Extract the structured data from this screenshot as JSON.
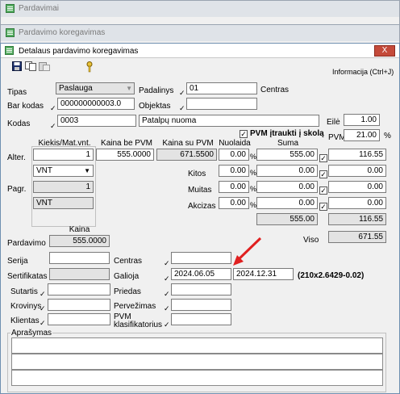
{
  "bg_windows": [
    "Pardavimai",
    "Pardavimo koregavimas"
  ],
  "dialog_title": "Detalaus pardavimo koregavimas",
  "close_label": "X",
  "info_label": "Informacija (Ctrl+J)",
  "form": {
    "tipas": {
      "label": "Tipas",
      "value": "Paslauga"
    },
    "padalinys": {
      "label": "Padalinys",
      "value": "01",
      "name": "Centras"
    },
    "barkodas": {
      "label": "Bar kodas",
      "value": "000000000003.0"
    },
    "objektas": {
      "label": "Objektas",
      "value": ""
    },
    "kodas": {
      "label": "Kodas",
      "value": "0003",
      "name": "Patalpų nuoma"
    },
    "eile": {
      "label": "Eilė",
      "value": "1.00"
    },
    "pvm_itraukti": {
      "label": "PVM įtraukti į skolą",
      "checked": true
    },
    "pvm": {
      "label": "PVM",
      "value": "21.00",
      "unit": "%"
    }
  },
  "table_headers": {
    "kiekis": "Kiekis/Mat.vnt.",
    "kaina_be": "Kaina be PVM",
    "kaina_su": "Kaina su PVM",
    "nuolaida": "Nuolaida",
    "suma": "Suma"
  },
  "alter": {
    "label": "Alter.",
    "kiekis": "1",
    "kaina_be": "555.0000",
    "kaina_su": "671.5500",
    "nuolaida": "0.00",
    "suma": "555.00",
    "pvm_suma": "116.55"
  },
  "unit_select": "VNT",
  "pagr": {
    "label": "Pagr.",
    "kiekis": "1",
    "unit": "VNT"
  },
  "kitos": {
    "label": "Kitos",
    "value": "0.00",
    "suma": "0.00",
    "pvm": "0.00"
  },
  "muitas": {
    "label": "Muitas",
    "value": "0.00",
    "suma": "0.00",
    "pvm": "0.00"
  },
  "akcizas": {
    "label": "Akcizas",
    "value": "0.00",
    "suma": "0.00",
    "pvm": "0.00"
  },
  "totals": {
    "suma": "555.00",
    "pvm": "116.55",
    "viso_label": "Viso",
    "viso": "671.55"
  },
  "kaina_hdr": "Kaina",
  "pardavimo": {
    "label": "Pardavimo",
    "value": "555.0000"
  },
  "serija": {
    "label": "Serija",
    "value": ""
  },
  "centras": {
    "label": "Centras",
    "value": ""
  },
  "sertifikatas": {
    "label": "Sertifikatas",
    "value": ""
  },
  "galioja": {
    "label": "Galioja",
    "from": "2024.06.05",
    "to": "2024.12.31",
    "note": "(210x2.6429-0.02)"
  },
  "sutartis": {
    "label": "Sutartis"
  },
  "priedas": {
    "label": "Priedas"
  },
  "krovinys": {
    "label": "Krovinys"
  },
  "perzimas": {
    "label": "Pervežimas"
  },
  "klientas": {
    "label": "Klientas"
  },
  "pvm_klas": {
    "label1": "PVM",
    "label2": "klasifikatorius"
  },
  "aprasymas": {
    "label": "Aprašymas"
  }
}
